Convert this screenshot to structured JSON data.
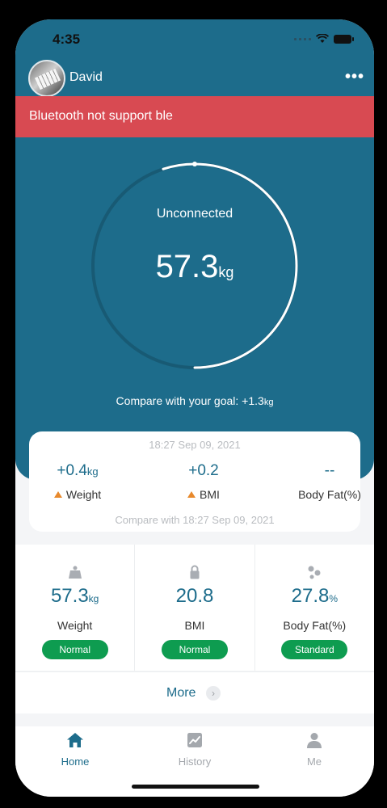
{
  "status_bar": {
    "time": "4:35"
  },
  "user": {
    "name": "David"
  },
  "alert": {
    "text": "Bluetooth not support ble"
  },
  "gauge": {
    "status": "Unconnected",
    "value": "57.3",
    "unit": "kg",
    "progress": 0.55
  },
  "goal": {
    "label": "Compare with your goal: +1.3",
    "unit": "kg"
  },
  "compare": {
    "date": "18:27 Sep 09, 2021",
    "items": [
      {
        "value": "+0.4",
        "unit": "kg",
        "label": "Weight",
        "trend": "up"
      },
      {
        "value": "+0.2",
        "unit": "",
        "label": "BMI",
        "trend": "up"
      },
      {
        "value": "--",
        "unit": "",
        "label": "Body Fat(%)",
        "trend": "none"
      }
    ],
    "footer": "Compare with 18:27 Sep 09, 2021"
  },
  "metrics": [
    {
      "icon": "weight-icon",
      "value": "57.3",
      "unit": "kg",
      "label": "Weight",
      "badge": "Normal"
    },
    {
      "icon": "bmi-lock-icon",
      "value": "20.8",
      "unit": "",
      "label": "BMI",
      "badge": "Normal"
    },
    {
      "icon": "body-fat-icon",
      "value": "27.8",
      "unit": "%",
      "label": "Body Fat(%)",
      "badge": "Standard"
    }
  ],
  "more": {
    "label": "More"
  },
  "tabs": [
    {
      "label": "Home",
      "icon": "home-icon",
      "active": true
    },
    {
      "label": "History",
      "icon": "history-chart-icon",
      "active": false
    },
    {
      "label": "Me",
      "icon": "person-icon",
      "active": false
    }
  ],
  "colors": {
    "primary": "#1d6c8b",
    "alert": "#d84a52",
    "badge": "#0e9c50",
    "trend_up": "#e8892c"
  }
}
